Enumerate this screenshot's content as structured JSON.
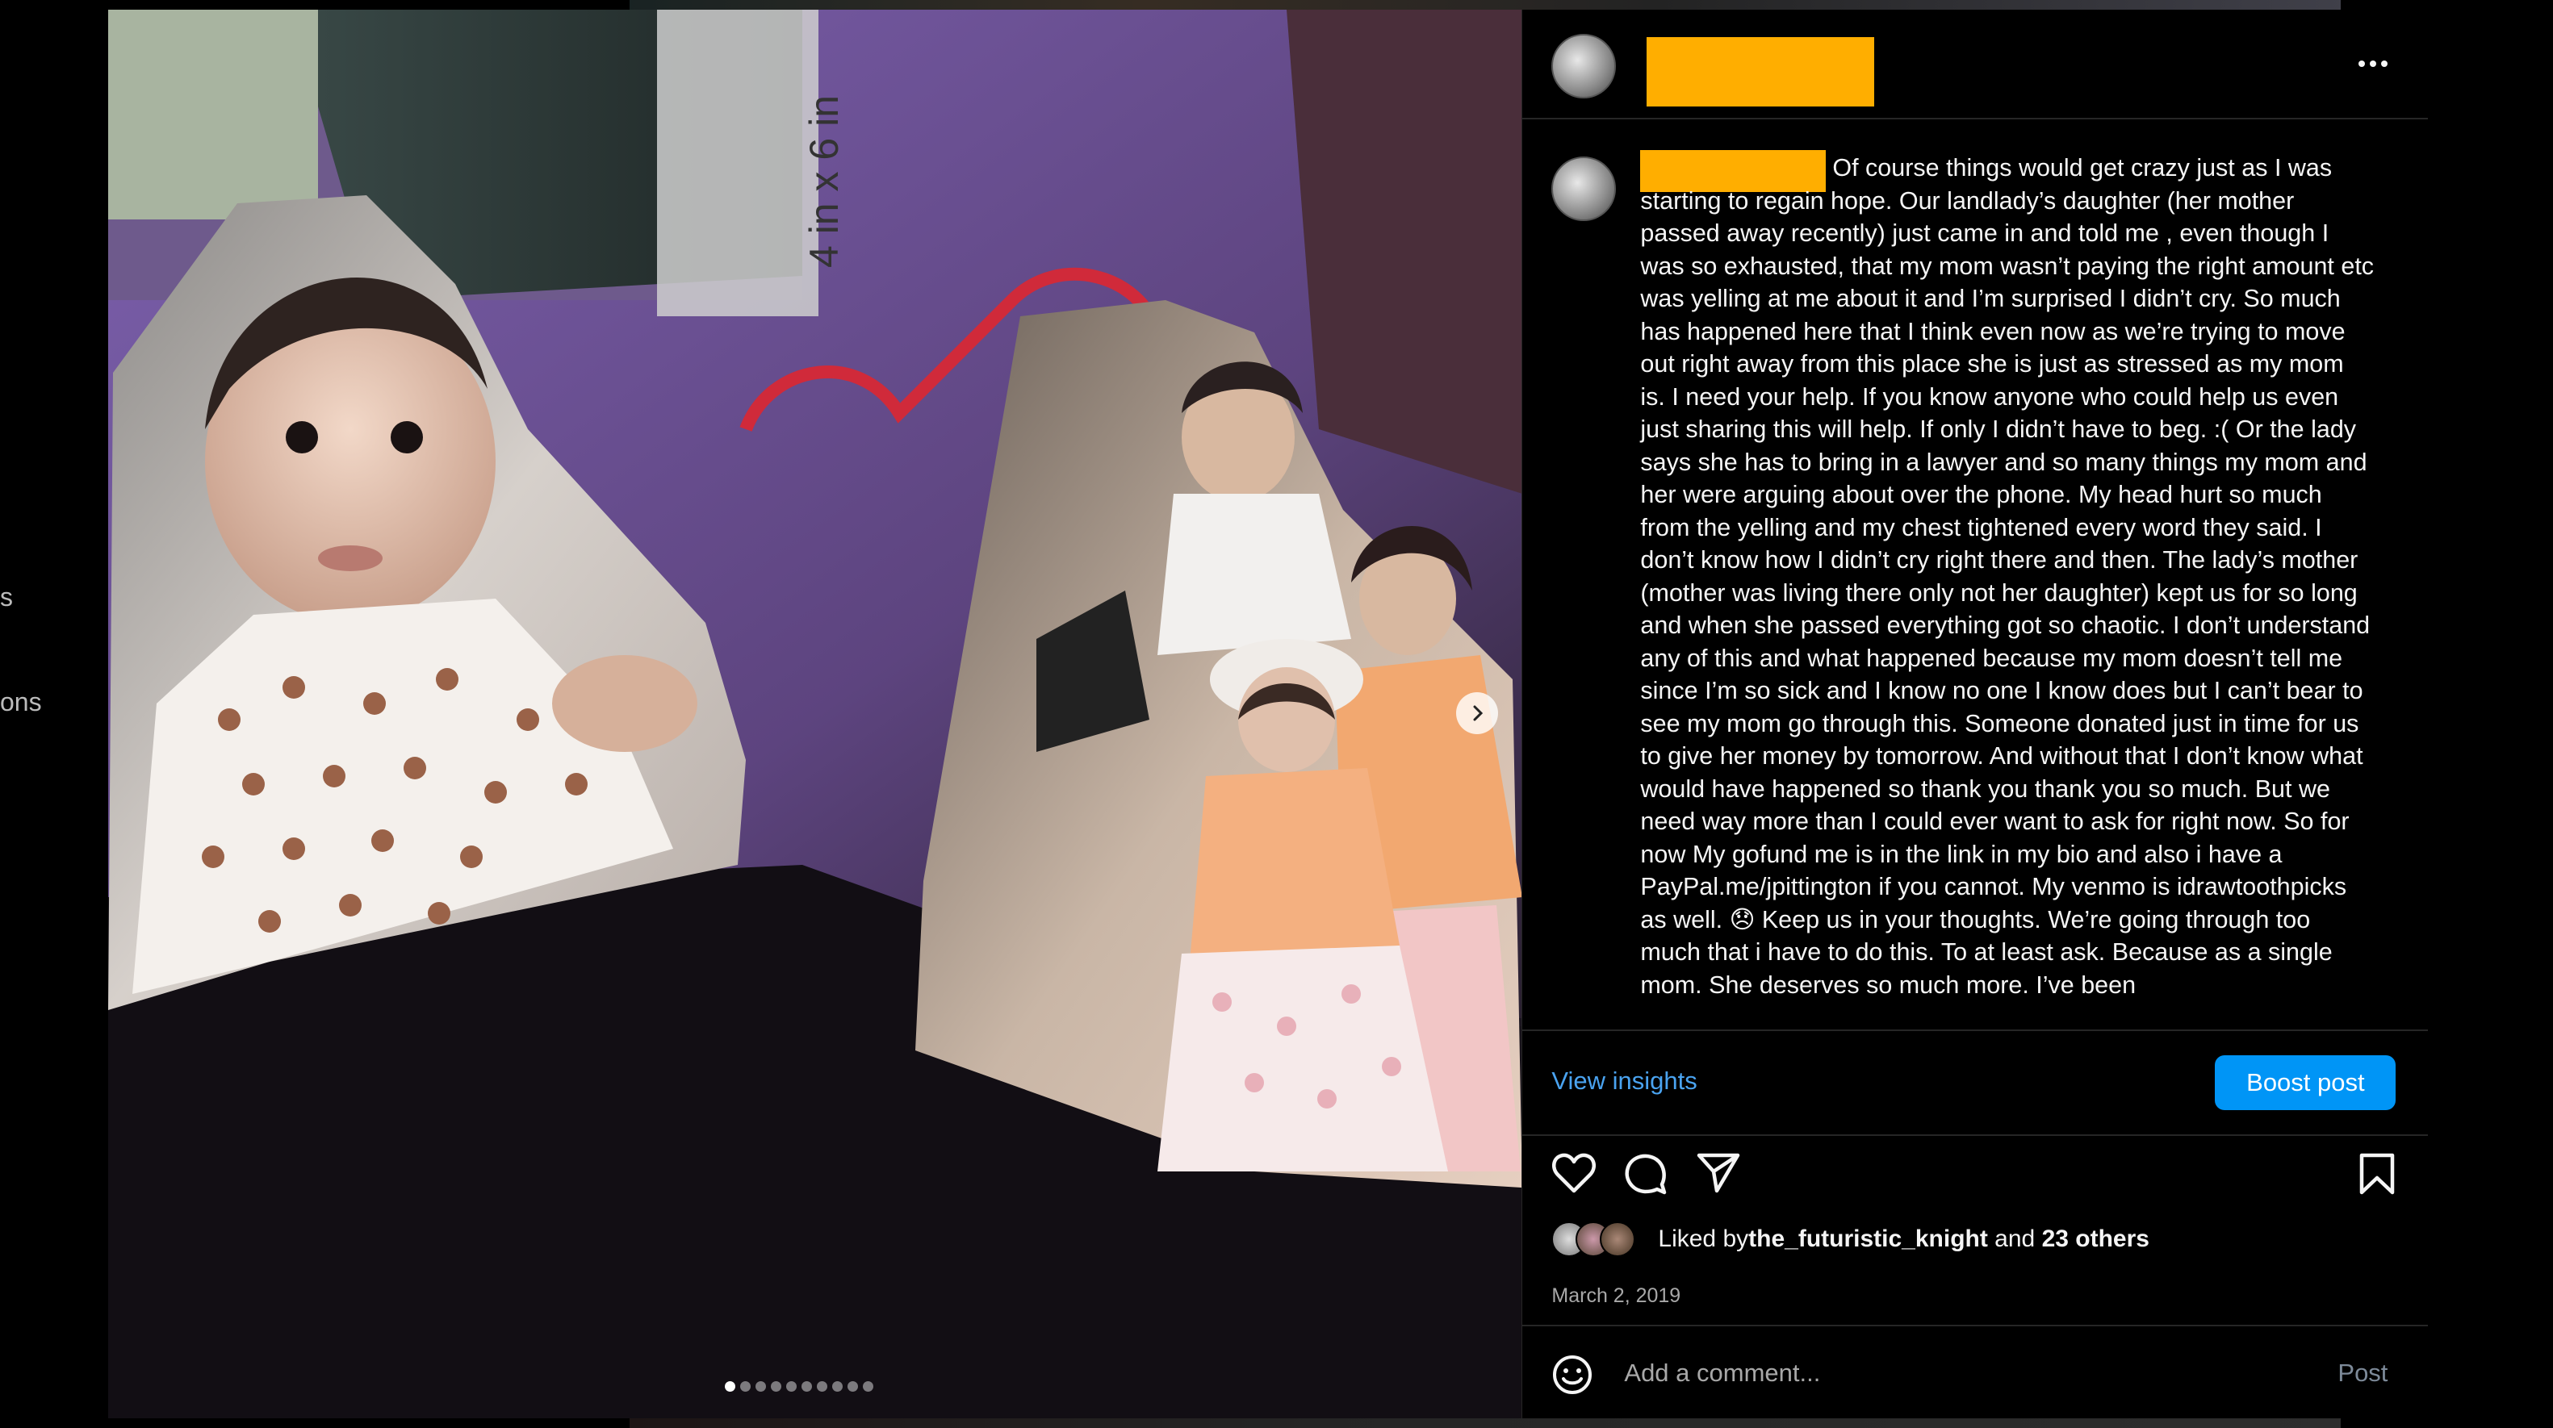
{
  "background": {
    "left_fragment_1": "s",
    "left_fragment_2": "ons"
  },
  "post": {
    "username": "",
    "more_icon": "more-horizontal-icon",
    "caption": "Of course things would get crazy just as I was starting to regain hope. Our landlady’s daughter (her mother passed away recently) just came in and told me , even though I was so exhausted, that my mom wasn’t paying the right amount etc was yelling at me about it and I’m surprised I didn’t cry. So much has happened here that I think even now as we’re trying to move out right away from this place she is just as stressed as my mom is. I need your help. If you know anyone who could help us even just sharing this will help. If only I didn’t have to beg. :( Or the lady says she has to bring in a lawyer and so many things my mom and her were arguing about over the phone. My head hurt so much from the yelling and my chest tightened every word they said. I don’t know how I didn’t cry right there and then. The lady’s mother (mother was living there only not her daughter) kept us for so long and when she passed everything got so chaotic. I don’t understand any of this and what happened because my mom doesn’t tell me since I’m so sick and I know no one I know does but I can’t bear to see my mom go through this. Someone donated just in time for us to give her money by tomorrow. And without that I don’t know what would have happened so thank you thank you so much. But we need way more than I could ever want to ask for right now. So for now My gofund me is in the link in my bio and also i have a PayPal.me/jpittington if you cannot. My venmo is idrawtoothpicks as well. 😞 Keep us in your thoughts. We’re going through too much that i have to do this. To at least ask. Because as a single mom. She deserves so much more. I’ve been",
    "photo_label": "4 in x 6 in",
    "carousel": {
      "total": 10,
      "current": 1
    },
    "insights_label": "View insights",
    "boost_label": "Boost post",
    "icons": [
      "heart-icon",
      "comment-icon",
      "share-icon",
      "bookmark-icon"
    ],
    "likes": {
      "prefix": "Liked by ",
      "user": "the_futuristic_knight",
      "middle": " and ",
      "others": "23 others"
    },
    "date": "March 2, 2019",
    "comment": {
      "placeholder": "Add a comment...",
      "post_label": "Post"
    }
  },
  "colors": {
    "redaction": "#ffae00",
    "link": "#4aa3f0",
    "boost": "#0095f6"
  }
}
